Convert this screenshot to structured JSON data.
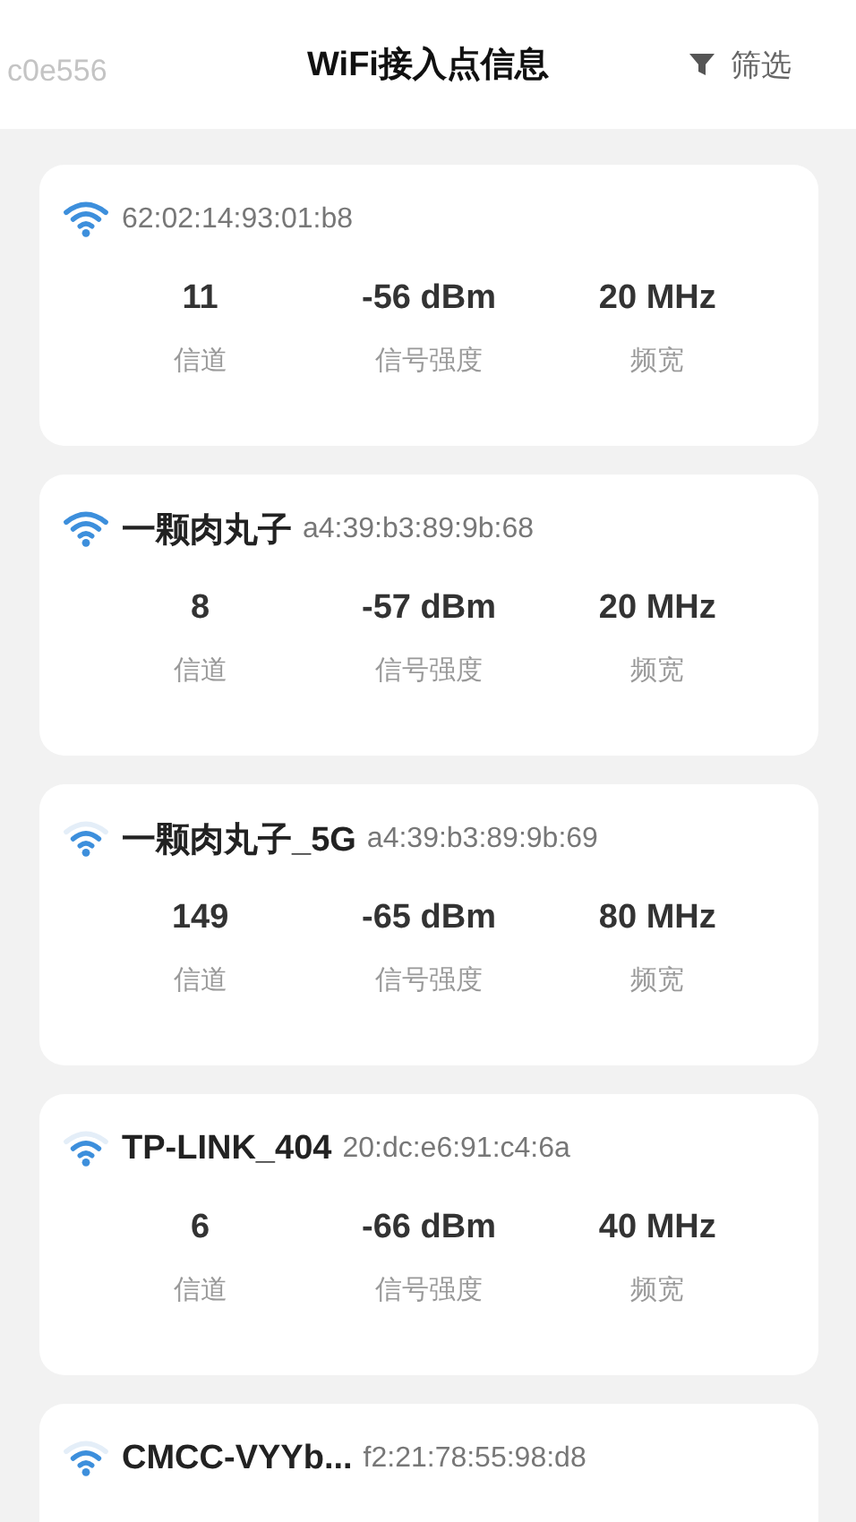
{
  "header": {
    "device_id": "c0e556",
    "title": "WiFi接入点信息",
    "filter_label": "筛选"
  },
  "access_points": [
    {
      "bssid": "62:02:14:93:01:b8",
      "signal_full": true,
      "stats": [
        {
          "value": "11",
          "label": "信道"
        },
        {
          "value": "-56 dBm",
          "label": "信号强度"
        },
        {
          "value": "20 MHz",
          "label": "频宽"
        }
      ]
    },
    {
      "ssid": "一颗肉丸子",
      "bssid": "a4:39:b3:89:9b:68",
      "signal_full": true,
      "stats": [
        {
          "value": "8",
          "label": "信道"
        },
        {
          "value": "-57 dBm",
          "label": "信号强度"
        },
        {
          "value": "20 MHz",
          "label": "频宽"
        }
      ]
    },
    {
      "ssid": "一颗肉丸子_5G",
      "bssid": "a4:39:b3:89:9b:69",
      "signal_full": false,
      "stats": [
        {
          "value": "149",
          "label": "信道"
        },
        {
          "value": "-65 dBm",
          "label": "信号强度"
        },
        {
          "value": "80 MHz",
          "label": "频宽"
        }
      ]
    },
    {
      "ssid": "TP-LINK_404",
      "bssid": "20:dc:e6:91:c4:6a",
      "signal_full": false,
      "stats": [
        {
          "value": "6",
          "label": "信道"
        },
        {
          "value": "-66 dBm",
          "label": "信号强度"
        },
        {
          "value": "40 MHz",
          "label": "频宽"
        }
      ]
    },
    {
      "ssid": "CMCC-VYYb...",
      "bssid": "f2:21:78:55:98:d8",
      "signal_full": false
    }
  ]
}
